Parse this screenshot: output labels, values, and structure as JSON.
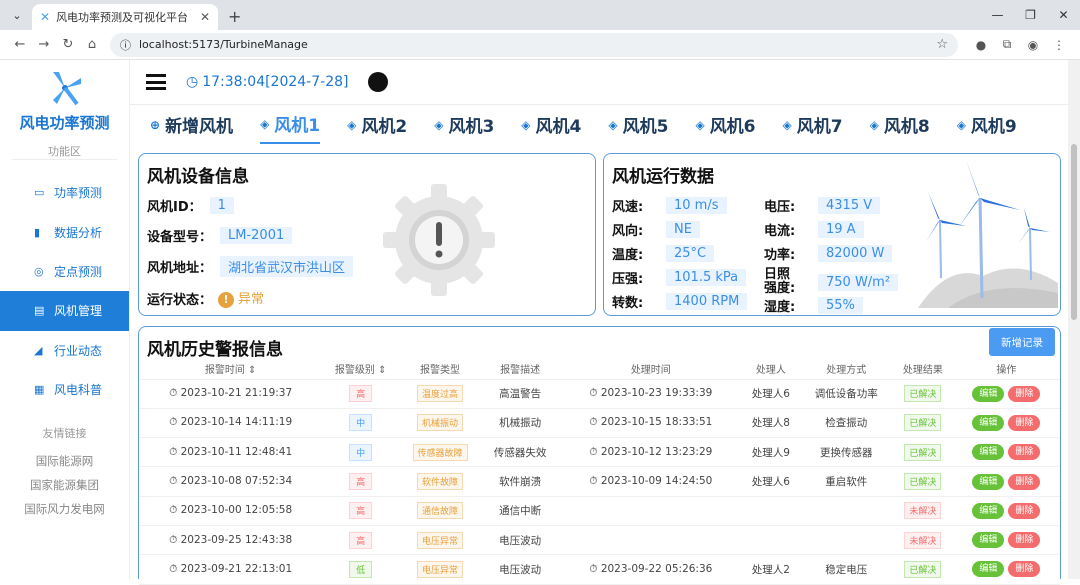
{
  "browser": {
    "tab_title": "风电功率预测及可视化平台",
    "url": "localhost:5173/TurbineManage"
  },
  "sidebar": {
    "brand": "风电功率预测",
    "section_label": "功能区",
    "items": [
      {
        "label": "功率预测",
        "icon": "monitor-icon"
      },
      {
        "label": "数据分析",
        "icon": "bar-chart-icon"
      },
      {
        "label": "定点预测",
        "icon": "location-icon"
      },
      {
        "label": "风机管理",
        "icon": "document-icon",
        "active": true
      },
      {
        "label": "行业动态",
        "icon": "trend-icon"
      },
      {
        "label": "风电科普",
        "icon": "grid-icon"
      }
    ],
    "links_label": "友情链接",
    "links": [
      "国际能源网",
      "国家能源集团",
      "国际风力发电网"
    ]
  },
  "header": {
    "clock": "17:38:04[2024-7-28]"
  },
  "tabs": [
    "新增风机",
    "风机1",
    "风机2",
    "风机3",
    "风机4",
    "风机5",
    "风机6",
    "风机7",
    "风机8",
    "风机9"
  ],
  "device": {
    "title": "风机设备信息",
    "id_label": "风机ID：",
    "id": "1",
    "model_label": "设备型号：",
    "model": "LM-2001",
    "addr_label": "风机地址：",
    "addr": "湖北省武汉市洪山区",
    "status_label": "运行状态：",
    "status": "异常"
  },
  "running": {
    "title": "风机运行数据",
    "left": [
      {
        "label": "风速:",
        "value": "10 m/s"
      },
      {
        "label": "风向:",
        "value": "NE"
      },
      {
        "label": "温度:",
        "value": "25°C"
      },
      {
        "label": "压强:",
        "value": "101.5 kPa"
      },
      {
        "label": "转数:",
        "value": "1400 RPM"
      }
    ],
    "right": [
      {
        "label": "电压:",
        "value": "4315 V"
      },
      {
        "label": "电流:",
        "value": "19 A"
      },
      {
        "label": "功率:",
        "value": "82000 W"
      },
      {
        "label": "日照强度:",
        "value": "750 W/m²"
      },
      {
        "label": "湿度:",
        "value": "55%"
      }
    ]
  },
  "history": {
    "title": "风机历史警报信息",
    "add_label": "新增记录",
    "headers": [
      "报警时间",
      "报警级别",
      "报警类型",
      "报警描述",
      "处理时间",
      "处理人",
      "处理方式",
      "处理结果",
      "操作"
    ],
    "edit": "编辑",
    "del": "删除",
    "rows": [
      {
        "t": "2023-10-21 21:19:37",
        "lv": "高",
        "lvc": "high",
        "type": "温度过高",
        "desc": "高温警告",
        "pt": "2023-10-23 19:33:39",
        "who": "处理人6",
        "how": "调低设备功率",
        "res": "已解决",
        "ok": true
      },
      {
        "t": "2023-10-14 14:11:19",
        "lv": "中",
        "lvc": "mid",
        "type": "机械振动",
        "desc": "机械振动",
        "pt": "2023-10-15 18:33:51",
        "who": "处理人8",
        "how": "检查振动",
        "res": "已解决",
        "ok": true
      },
      {
        "t": "2023-10-11 12:48:41",
        "lv": "中",
        "lvc": "mid",
        "type": "传感器故障",
        "desc": "传感器失效",
        "pt": "2023-10-12 13:23:29",
        "who": "处理人9",
        "how": "更换传感器",
        "res": "已解决",
        "ok": true
      },
      {
        "t": "2023-10-08 07:52:34",
        "lv": "高",
        "lvc": "high",
        "type": "软件故障",
        "desc": "软件崩溃",
        "pt": "2023-10-09 14:24:50",
        "who": "处理人6",
        "how": "重启软件",
        "res": "已解决",
        "ok": true
      },
      {
        "t": "2023-10-00 12:05:58",
        "lv": "高",
        "lvc": "high",
        "type": "通信故障",
        "desc": "通信中断",
        "pt": "",
        "who": "",
        "how": "",
        "res": "未解决",
        "ok": false
      },
      {
        "t": "2023-09-25 12:43:38",
        "lv": "高",
        "lvc": "high",
        "type": "电压异常",
        "desc": "电压波动",
        "pt": "",
        "who": "",
        "how": "",
        "res": "未解决",
        "ok": false
      },
      {
        "t": "2023-09-21 22:13:01",
        "lv": "低",
        "lvc": "low",
        "type": "电压异常",
        "desc": "电压波动",
        "pt": "2023-09-22 05:26:36",
        "who": "处理人2",
        "how": "稳定电压",
        "res": "已解决",
        "ok": true
      }
    ]
  }
}
